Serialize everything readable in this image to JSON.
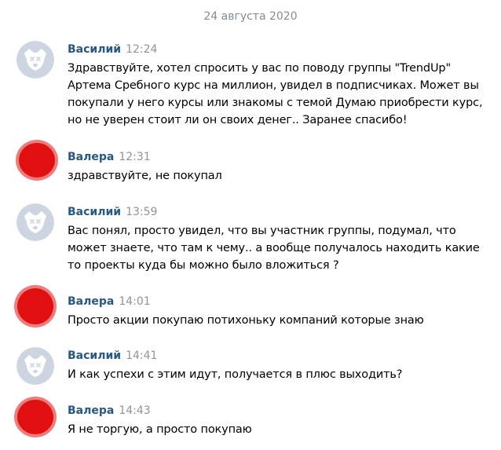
{
  "date_divider": "24 августа 2020",
  "colors": {
    "author": "#2a5885",
    "time": "#939393",
    "date": "#818c99",
    "avatar_default_bg": "#cdd6e0",
    "avatar_redacted": "#e01010"
  },
  "messages": [
    {
      "author": "Василий",
      "time": "12:24",
      "avatar": "default-dog-avatar-icon",
      "text": "Здравствуйте, хотел спросить у вас по поводу группы \"TrendUp\" Артема Сребного курс на миллион, увидел в подписчиках. Может вы покупали у него курсы или знакомы с темой Думаю приобрести курс, но не уверен стоит ли он своих денег.. Заранее спасибо!"
    },
    {
      "author": "Валера",
      "time": "12:31",
      "avatar": "redacted-avatar-icon",
      "text": "здравствуйте, не покупал"
    },
    {
      "author": "Василий",
      "time": "13:59",
      "avatar": "default-dog-avatar-icon",
      "text": "Вас понял, просто увидел, что вы участник группы, подумал, что может знаете, что там к чему.. а вообще получалось находить какие то проекты куда бы можно было вложиться ?"
    },
    {
      "author": "Валера",
      "time": "14:01",
      "avatar": "redacted-avatar-icon",
      "text": "Просто акции покупаю потихоньку компаний которые знаю"
    },
    {
      "author": "Василий",
      "time": "14:41",
      "avatar": "default-dog-avatar-icon",
      "text": "И как успехи с этим идут, получается в плюс выходить?"
    },
    {
      "author": "Валера",
      "time": "14:43",
      "avatar": "redacted-avatar-icon",
      "text": "Я не торгую, а просто покупаю"
    }
  ]
}
